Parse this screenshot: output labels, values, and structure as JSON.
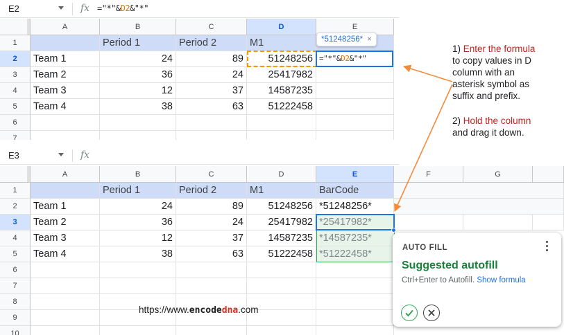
{
  "top": {
    "name_box": "E2",
    "fx_icon": "fx",
    "formula_bar": {
      "p1": "=\"*\"&",
      "ref": "D2",
      "p2": "&\"*\""
    },
    "columns": [
      "A",
      "B",
      "C",
      "D",
      "E"
    ],
    "rows": [
      "1",
      "2",
      "3",
      "4",
      "5",
      "6",
      "7"
    ],
    "headers": {
      "b": "Period 1",
      "c": "Period 2",
      "d": "M1"
    },
    "data": [
      {
        "team": "Team 1",
        "p1": "24",
        "p2": "89",
        "m1": "51248256"
      },
      {
        "team": "Team 2",
        "p1": "36",
        "p2": "24",
        "m1": "25417982"
      },
      {
        "team": "Team 3",
        "p1": "12",
        "p2": "37",
        "m1": "14587235"
      },
      {
        "team": "Team 4",
        "p1": "38",
        "p2": "63",
        "m1": "51222458"
      }
    ],
    "tooltip": {
      "value": "*51248256*",
      "close": "×"
    },
    "edit_cell": {
      "p1": "=\"*\"&",
      "ref": "D2",
      "p2": "&\"*\""
    }
  },
  "bottom": {
    "name_box": "E3",
    "fx_icon": "fx",
    "columns": [
      "A",
      "B",
      "C",
      "D",
      "E",
      "F",
      "G"
    ],
    "rows": [
      "1",
      "2",
      "3",
      "4",
      "5",
      "6",
      "7",
      "8",
      "9",
      "10"
    ],
    "headers": {
      "b": "Period 1",
      "c": "Period 2",
      "d": "M1",
      "e": "BarCode"
    },
    "data": [
      {
        "team": "Team 1",
        "p1": "24",
        "p2": "89",
        "m1": "51248256",
        "bar": "*51248256*"
      },
      {
        "team": "Team 2",
        "p1": "36",
        "p2": "24",
        "m1": "25417982",
        "bar": "*25417982*"
      },
      {
        "team": "Team 3",
        "p1": "12",
        "p2": "37",
        "m1": "14587235",
        "bar": "*14587235*"
      },
      {
        "team": "Team 4",
        "p1": "38",
        "p2": "63",
        "m1": "51222458",
        "bar": "*51222458*"
      }
    ]
  },
  "notes": {
    "n1_num": "1)",
    "n1_red": "Enter the formula",
    "n1_rest": [
      "to copy values in D",
      "column with an",
      "asterisk symbol as",
      "suffix and prefix."
    ],
    "n2_num": "2)",
    "n2_red": "Hold the column",
    "n2_rest": "and drag it down."
  },
  "url": {
    "prefix": "https://www.",
    "brand1": "encode",
    "brand2": "dna",
    "suffix": ".com"
  },
  "autofill": {
    "title": "AUTO FILL",
    "heading": "Suggested autofill",
    "sub": "Ctrl+Enter to Autofill.",
    "link": "Show formula"
  },
  "colors": {
    "accent": "#1a73e8",
    "arrow": "#f58a3a",
    "header_fill": "#cfdcf7",
    "success": "#188038"
  }
}
